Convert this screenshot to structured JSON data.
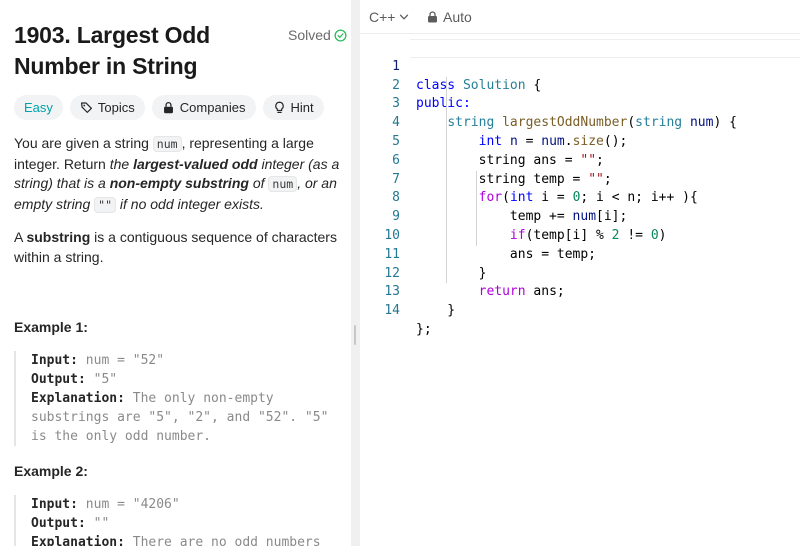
{
  "problem": {
    "title": "1903. Largest Odd Number in String",
    "status": "Solved",
    "tags": {
      "difficulty": "Easy",
      "topics": "Topics",
      "companies": "Companies",
      "hint": "Hint"
    },
    "description": {
      "p1": {
        "t1": "You are given a string ",
        "c1": "num",
        "t2": ", representing a large integer. Return ",
        "i1": "the ",
        "b1": "largest-valued odd",
        "i2": " integer (as a string) that is a ",
        "b2": "non-empty substring",
        "i3": " of ",
        "c2": "num",
        "i4": ", or an empty string ",
        "c3": "\"\"",
        "i5": " if no odd integer exists."
      },
      "p2": {
        "t1": "A ",
        "b1": "substring",
        "t2": " is a contiguous sequence of characters within a string."
      }
    },
    "examples": [
      {
        "heading": "Example 1:",
        "input_label": "Input:",
        "input_value": " num = \"52\"",
        "output_label": "Output:",
        "output_value": " \"5\"",
        "explanation_label": "Explanation:",
        "explanation_value": " The only non-empty substrings are \"5\", \"2\", and \"52\". \"5\" is the only odd number."
      },
      {
        "heading": "Example 2:",
        "input_label": "Input:",
        "input_value": " num = \"4206\"",
        "output_label": "Output:",
        "output_value": " \"\"",
        "explanation_label": "Explanation:",
        "explanation_value": " There are no odd numbers"
      }
    ]
  },
  "editor": {
    "language": "C++",
    "mode": "Auto",
    "line_numbers": [
      "1",
      "2",
      "3",
      "4",
      "5",
      "6",
      "7",
      "8",
      "9",
      "10",
      "11",
      "12",
      "13",
      "14"
    ],
    "code": {
      "l1": [
        "class",
        " ",
        "Solution",
        " {"
      ],
      "l2": [
        "public:"
      ],
      "l3": [
        "    ",
        "string",
        " ",
        "largestOddNumber",
        "(",
        "string",
        " ",
        "num",
        ") {"
      ],
      "l4": [
        "        ",
        "int",
        " ",
        "n",
        " = ",
        "num",
        ".",
        "size",
        "();"
      ],
      "l5": [
        "        string ans = ",
        "\"\"",
        ";"
      ],
      "l6": [
        "        string temp = ",
        "\"\"",
        ";"
      ],
      "l7": [
        "        ",
        "for",
        "(",
        "int",
        " i = ",
        "0",
        "; i < n; i++ ){"
      ],
      "l8": [
        "            temp += ",
        "num",
        "[i];"
      ],
      "l9": [
        "            ",
        "if",
        "(temp[i] % ",
        "2",
        " != ",
        "0",
        ")"
      ],
      "l10": [
        "            ans = temp;"
      ],
      "l11": [
        "        }"
      ],
      "l12": [
        "        ",
        "return",
        " ans;"
      ],
      "l13": [
        "    }"
      ],
      "l14": [
        "};"
      ]
    }
  },
  "colors": {
    "easy": "#00a3a6",
    "solved_check": "#2cbb5d",
    "keyword": "#0000ff",
    "control": "#af00db",
    "type": "#267f99",
    "function": "#795e26",
    "string": "#a31515",
    "number": "#098658",
    "line_number": "#237893"
  }
}
